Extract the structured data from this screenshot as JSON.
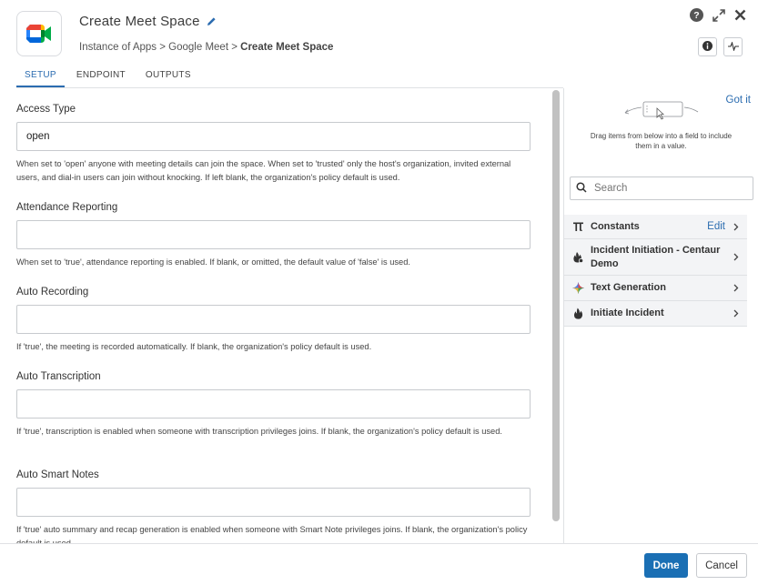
{
  "header": {
    "title": "Create Meet Space",
    "breadcrumb": {
      "part1": "Instance of Apps",
      "sep": ">",
      "part2": "Google Meet",
      "current": "Create Meet Space"
    }
  },
  "tabs": [
    {
      "label": "SETUP",
      "active": true
    },
    {
      "label": "ENDPOINT",
      "active": false
    },
    {
      "label": "OUTPUTS",
      "active": false
    }
  ],
  "fields": [
    {
      "label": "Access Type",
      "value": "open",
      "help": "When set to 'open' anyone with meeting details can join the space. When set to 'trusted' only the host's organization, invited external users, and dial-in users can join without knocking. If left blank, the organization's policy default is used."
    },
    {
      "label": "Attendance Reporting",
      "value": "",
      "help": "When set to 'true', attendance reporting is enabled. If blank, or omitted, the default value of 'false' is used."
    },
    {
      "label": "Auto Recording",
      "value": "",
      "help": "If 'true', the meeting is recorded automatically. If blank, the organization's policy default is used."
    },
    {
      "label": "Auto Transcription",
      "value": "",
      "help": "If 'true', transcription is enabled when someone with transcription privileges joins. If blank, the organization's policy default is used."
    },
    {
      "label": "Auto Smart Notes",
      "value": "",
      "help": "If 'true' auto summary and recap generation is enabled when someone with Smart Note privileges joins. If blank, the organization's policy default is used."
    }
  ],
  "side": {
    "got_it": "Got it",
    "hint": "Drag items from below into a field to include them in a value.",
    "search_placeholder": "Search",
    "items": [
      {
        "label": "Constants",
        "icon": "pi-icon",
        "edit": "Edit"
      },
      {
        "label": "Incident Initiation - Centaur Demo",
        "icon": "incident-initiation-icon"
      },
      {
        "label": "Text Generation",
        "icon": "sparkle-icon"
      },
      {
        "label": "Initiate Incident",
        "icon": "flame-icon"
      }
    ]
  },
  "footer": {
    "done_label": "Done",
    "cancel_label": "Cancel"
  },
  "colors": {
    "accent": "#2b6cb0",
    "primary_button": "#1a6fb4"
  }
}
